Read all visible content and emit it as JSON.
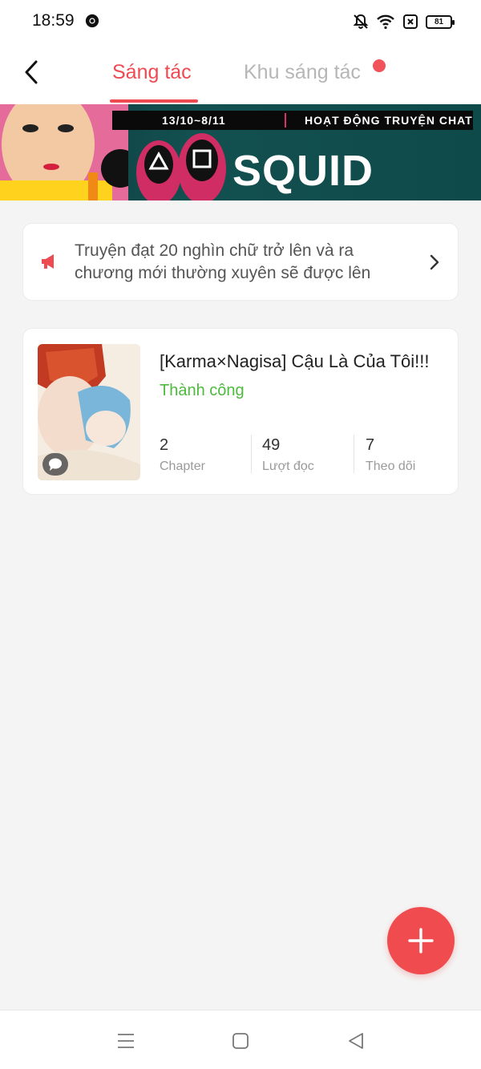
{
  "status_bar": {
    "time": "18:59",
    "battery": "81",
    "icons": [
      "chrome-icon",
      "bell-off-icon",
      "wifi-icon",
      "sim-icon",
      "battery-icon"
    ]
  },
  "header": {
    "back_icon": "chevron-left-icon",
    "tab_active": "Sáng tác",
    "tab_inactive": "Khu sáng tác",
    "accent_color": "#ee4a52"
  },
  "banner": {
    "dates": "13/10~8/11",
    "event": "HOẠT ĐỘNG TRUYỆN CHAT",
    "logo": "SQUID GAME"
  },
  "notice": {
    "icon": "megaphone-icon",
    "text": "Truyện đạt 20 nghìn chữ trở lên và ra chương mới thường xuyên sẽ được lên"
  },
  "story": {
    "title": "[Karma×Nagisa] Cậu Là Của Tôi!!!",
    "status": "Thành công",
    "status_color": "#4cba3c",
    "stats": [
      {
        "value": "2",
        "label": "Chapter"
      },
      {
        "value": "49",
        "label": "Lượt đọc"
      },
      {
        "value": "7",
        "label": "Theo dõi"
      }
    ]
  },
  "fab": {
    "icon": "plus-icon"
  },
  "navbar": {
    "icons": [
      "menu-icon",
      "home-square-icon",
      "back-triangle-icon"
    ]
  }
}
